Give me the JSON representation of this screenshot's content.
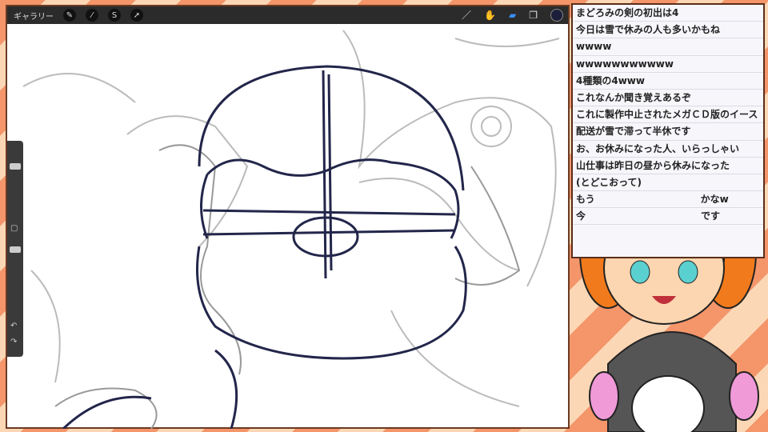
{
  "toolbar": {
    "gallery_label": "ギャラリー",
    "left_tools": [
      "wrench-icon",
      "magic-wand-icon",
      "selection-icon",
      "transform-icon"
    ],
    "right_tools": [
      "brush-icon",
      "smudge-icon",
      "eraser-icon",
      "layers-icon"
    ],
    "active_color": "#1c1f3a"
  },
  "sidebar": {
    "undo": "↶",
    "redo": "↷"
  },
  "chat": {
    "messages": [
      "まどろみの剣の初出は4",
      "今日は雪で休みの人も多いかもね",
      "wwww",
      "wwwwwwwwwww",
      "4種類の4www",
      "これなんか聞き覚えあるぞ",
      "これに製作中止されたメガＣＤ版のイース",
      "配送が雪で滞って半休です",
      "お、お休みになった人、いらっしゃい",
      "山仕事は昨日の昼から休みになった",
      "(とどこおって)",
      "もう　　　　　　　　　　　かなw",
      "今　　　　　　　　　　　　です"
    ]
  }
}
